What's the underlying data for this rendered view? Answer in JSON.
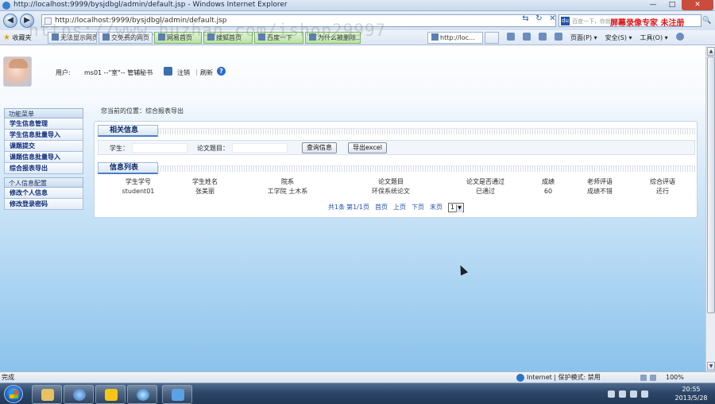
{
  "window": {
    "title": "http://localhost:9999/bysjdbgl/admin/default.jsp - Windows Internet Explorer",
    "minimize": "—",
    "maximize": "□",
    "close": "✕"
  },
  "addressbar": {
    "url": "http://localhost:9999/bysjdbgl/admin/default.jsp",
    "back_icon": "back-arrow-icon",
    "forward_icon": "forward-arrow-icon",
    "refresh_glyph": "↻",
    "stop_glyph": "✕",
    "compat_glyph": "⇆"
  },
  "searchbar": {
    "placeholder": "百度一下，你就知道",
    "brand_text": "屏幕录像专家 未注册",
    "go_glyph": "🔍"
  },
  "favorites": {
    "label": "收藏夹",
    "tabs": [
      {
        "label": "无法显示网页"
      },
      {
        "label": "交免费的网页"
      },
      {
        "label": "网易首页"
      },
      {
        "label": "搜狐首页"
      },
      {
        "label": "百度一下"
      },
      {
        "label": "为什么被删除..."
      },
      {
        "label": "http://loc..."
      }
    ],
    "tools": [
      {
        "label": "页面(P)"
      },
      {
        "label": "安全(S)"
      },
      {
        "label": "工具(O)"
      }
    ]
  },
  "watermark": "https://www.huzhan.com/ishop29997",
  "header": {
    "user_label": "用户:",
    "user_value": "ms01 --\"室\"-- 管辅秘书",
    "logout": "注销",
    "separator": "|",
    "refresh": "刷新",
    "help": "?"
  },
  "sidebar": {
    "groups": [
      {
        "title": "功能菜单",
        "items": [
          "学生信息管理",
          "学生信息批量导入",
          "课题提交",
          "课题信息批量导入",
          "综合报表导出"
        ]
      },
      {
        "title": "个人信息配置",
        "items": [
          "修改个人信息",
          "修改登录密码"
        ]
      }
    ]
  },
  "breadcrumb": "您当前的位置：综合报表导出",
  "query_section": {
    "title": "相关信息",
    "student_label": "学生：",
    "student_value": "",
    "thesis_label": "论文题目：",
    "thesis_value": "",
    "search_button": "查询信息",
    "export_button": "导出excel"
  },
  "list_section": {
    "title": "信息列表",
    "columns": [
      "学生学号",
      "学生姓名",
      "院系",
      "论文题目",
      "论文是否通过",
      "成绩",
      "老师评语",
      "综合评语"
    ],
    "rows": [
      [
        "student01",
        "张美丽",
        "工学院 土木系",
        "环保系统论文",
        "已通过",
        "60",
        "成绩不错",
        "还行"
      ]
    ]
  },
  "pager": {
    "total": "共1条",
    "page_info": "第1/1页",
    "first": "首页",
    "prev": "上页",
    "next": "下页",
    "last": "末页",
    "current": "1"
  },
  "statusbar": {
    "status": "完成",
    "zone": "Internet | 保护模式: 禁用",
    "zoom": "100%"
  },
  "taskbar": {
    "time": "20:55",
    "date": "2013/5/28"
  },
  "colors": {
    "menu_text": "#0d2c7a",
    "brand_red": "#e0151a",
    "taskbar": "#2c4668"
  }
}
